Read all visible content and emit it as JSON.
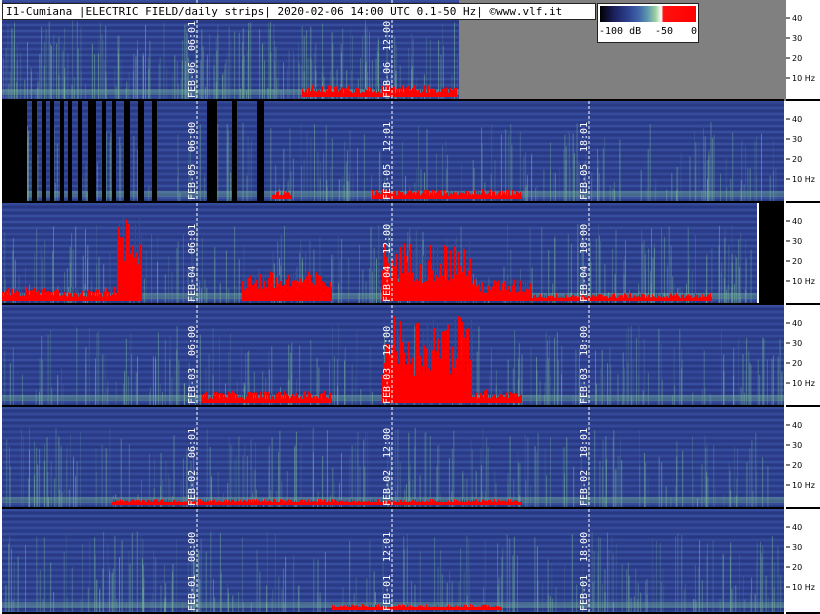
{
  "title": "I1-Cumiana |ELECTRIC FIELD/daily strips| 2020-02-06 14:00 UTC 0.1-50 Hz| ©www.vlf.it",
  "legend": {
    "labels": [
      "-100 dB",
      "-50",
      "0"
    ],
    "colors": [
      "#000000",
      "#2c3e8c",
      "#5f9bb0",
      "#ffffff",
      "#ff0000"
    ]
  },
  "axis": {
    "ticks": [
      "40",
      "30",
      "20",
      "10 Hz"
    ]
  },
  "colors": {
    "background": "#2e3f8f",
    "activity": "#7fc49a",
    "intense": "#ff0000",
    "missing": "#000000",
    "no_data": "#808080"
  },
  "strips": [
    {
      "date_label": "FEB-06",
      "time_labels": [
        "06:01",
        "12:00"
      ]
    },
    {
      "date_label": "FEB-05",
      "time_labels": [
        "06:00",
        "12:01",
        "18:01"
      ]
    },
    {
      "date_label": "FEB-04",
      "time_labels": [
        "06:01",
        "12:00",
        "18:00"
      ]
    },
    {
      "date_label": "FEB-03",
      "time_labels": [
        "06:00",
        "12:00",
        "18:00"
      ]
    },
    {
      "date_label": "FEB-02",
      "time_labels": [
        "06:01",
        "12:00",
        "18:01"
      ]
    },
    {
      "date_label": "FEB-01",
      "time_labels": [
        "06:00",
        "12:01",
        "18:00"
      ]
    }
  ]
}
